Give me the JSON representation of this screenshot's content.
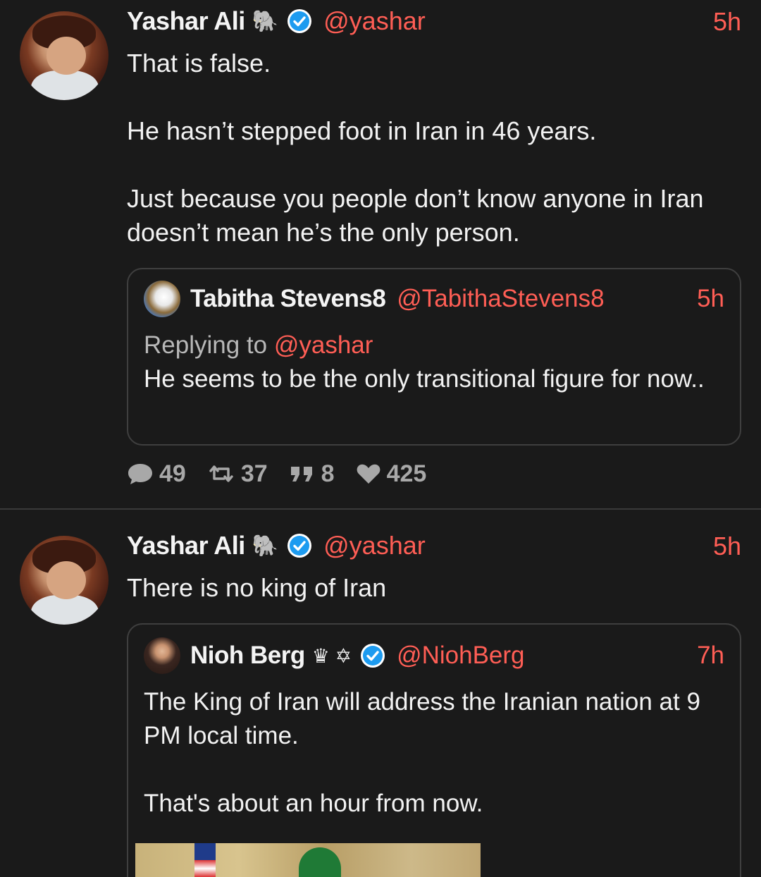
{
  "posts": [
    {
      "author_name": "Yashar Ali",
      "author_emoji": "🐘",
      "handle": "@yashar",
      "time": "5h",
      "text": "That is false.\n\nHe hasn’t stepped foot in Iran in 46 years.\n\nJust because you people don’t know anyone in Iran doesn’t mean he’s the only person.",
      "quote": {
        "author_name": "Tabitha Stevens8",
        "handle": "@TabithaStevens8",
        "time": "5h",
        "replying_prefix": "Replying to",
        "replying_to": "@yashar",
        "text": "He seems to be the only transitional figure for now.."
      },
      "stats": {
        "replies": "49",
        "reposts": "37",
        "quotes": "8",
        "likes": "425"
      }
    },
    {
      "author_name": "Yashar Ali",
      "author_emoji": "🐘",
      "handle": "@yashar",
      "time": "5h",
      "text": "There is no king of Iran",
      "quote": {
        "author_name": "Nioh Berg",
        "author_emoji": "♛ ✡",
        "handle": "@NiohBerg",
        "time": "7h",
        "text": "The King of Iran will address the Iranian nation at 9 PM local time.\n\nThat's about an hour from now."
      }
    }
  ],
  "colors": {
    "background": "#1a1a1a",
    "accent": "#ff5e55",
    "verified": "#1d9bf0",
    "muted": "#a8a8a8"
  },
  "icons": {
    "reply": "speech-bubble-icon",
    "repost": "repost-icon",
    "quote": "quote-icon",
    "like": "heart-icon",
    "verified": "verified-badge-icon"
  }
}
